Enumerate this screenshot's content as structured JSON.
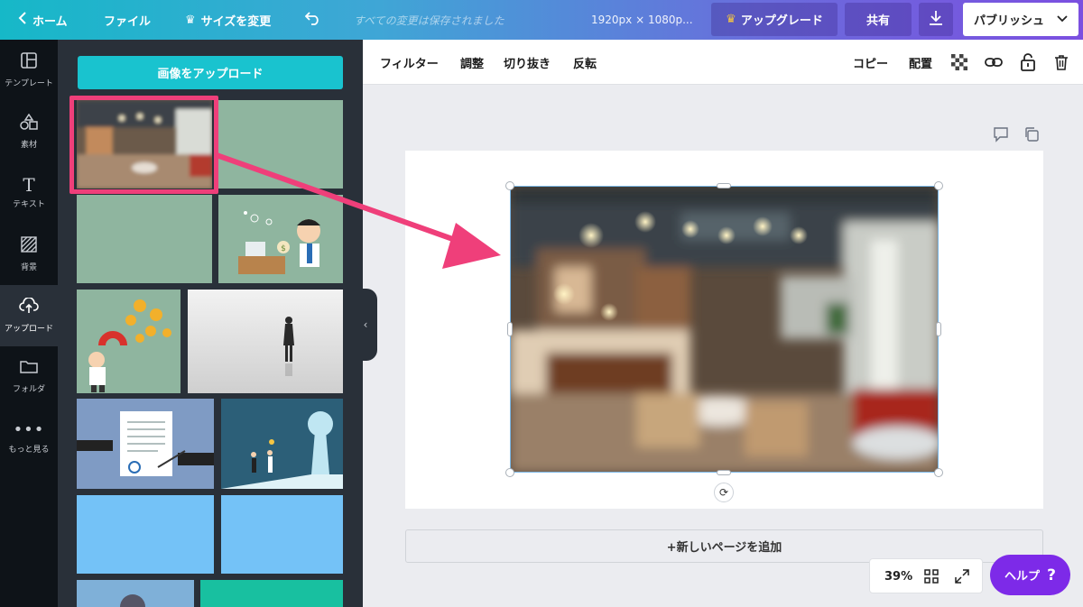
{
  "topbar": {
    "home": "ホーム",
    "file": "ファイル",
    "resize": "サイズを変更",
    "status": "すべての変更は保存されました",
    "dimensions": "1920px × 1080p...",
    "upgrade": "アップグレード",
    "share": "共有",
    "publish": "パブリッシュ"
  },
  "rail": {
    "items": [
      {
        "label": "テンプレート",
        "icon": "template-icon"
      },
      {
        "label": "素材",
        "icon": "elements-icon"
      },
      {
        "label": "テキスト",
        "icon": "text-icon"
      },
      {
        "label": "背景",
        "icon": "background-icon"
      },
      {
        "label": "アップロード",
        "icon": "upload-icon",
        "active": true
      },
      {
        "label": "フォルダ",
        "icon": "folder-icon"
      },
      {
        "label": "もっと見る",
        "icon": "more-icon"
      }
    ]
  },
  "panel": {
    "upload_button": "画像をアップロード"
  },
  "toolbar": {
    "filter": "フィルター",
    "adjust": "調整",
    "crop": "切り抜き",
    "flip": "反転",
    "copy": "コピー",
    "arrange": "配置"
  },
  "canvas": {
    "add_page": "+新しいページを追加"
  },
  "zoom": {
    "level": "39%"
  },
  "help": {
    "label": "ヘルプ",
    "mark": "?"
  },
  "colors": {
    "accent_teal": "#19c3cf",
    "highlight_pink": "#ef3f7a",
    "help_purple": "#7d2ae8"
  }
}
